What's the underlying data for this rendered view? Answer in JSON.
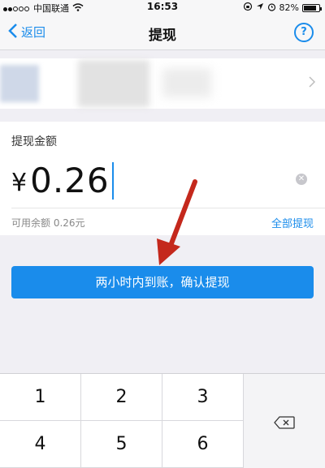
{
  "status_bar": {
    "carrier": "中国联通",
    "time": "16:53",
    "battery": "82%",
    "battery_level": 0.82
  },
  "nav": {
    "back_label": "返回",
    "title": "提现",
    "help_symbol": "?"
  },
  "amount": {
    "label": "提现金额",
    "currency": "¥",
    "value": "0.26",
    "balance_text": "可用余额 0.26元",
    "withdraw_all_label": "全部提现"
  },
  "confirm_button": {
    "label": "两小时内到账，确认提现"
  },
  "keypad": {
    "keys": [
      "1",
      "2",
      "3",
      "4",
      "5",
      "6"
    ]
  },
  "colors": {
    "accent": "#1a8ceb",
    "arrow": "#c4281c"
  }
}
